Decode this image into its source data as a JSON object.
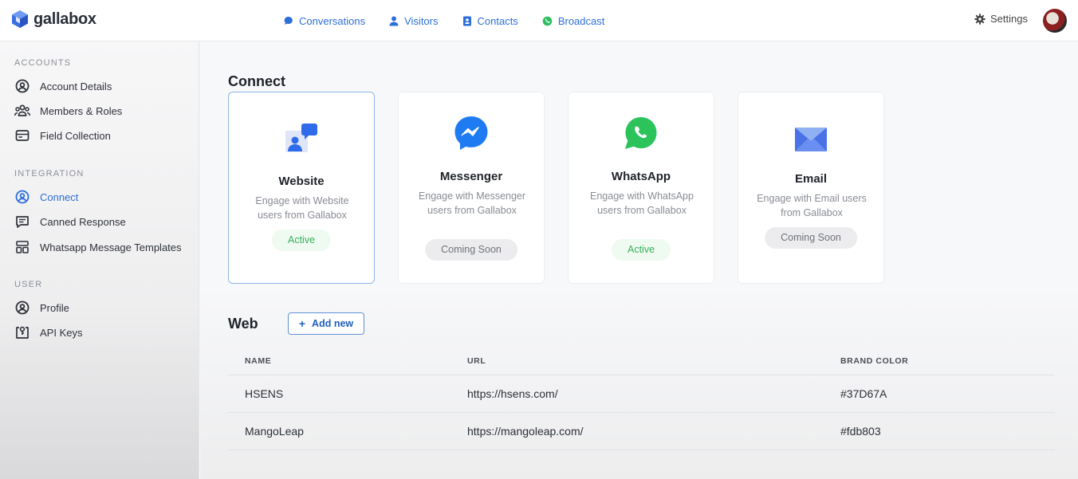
{
  "app": {
    "name": "gallabox"
  },
  "nav": {
    "items": [
      {
        "label": "Conversations",
        "icon": "chat-bubble-icon"
      },
      {
        "label": "Visitors",
        "icon": "person-icon"
      },
      {
        "label": "Contacts",
        "icon": "contact-card-icon"
      },
      {
        "label": "Broadcast",
        "icon": "whatsapp-icon"
      }
    ],
    "settings_label": "Settings"
  },
  "sidebar": {
    "accounts_title": "ACCOUNTS",
    "accounts": [
      {
        "label": "Account Details",
        "icon": "user-circle-icon"
      },
      {
        "label": "Members & Roles",
        "icon": "users-group-icon"
      },
      {
        "label": "Field Collection",
        "icon": "form-icon"
      }
    ],
    "integration_title": "INTEGRATION",
    "integration": [
      {
        "label": "Connect",
        "icon": "user-circle-icon",
        "active": true
      },
      {
        "label": "Canned Response",
        "icon": "message-icon"
      },
      {
        "label": "Whatsapp Message Templates",
        "icon": "template-icon"
      }
    ],
    "user_title": "USER",
    "user": [
      {
        "label": "Profile",
        "icon": "user-circle-icon"
      },
      {
        "label": "API Keys",
        "icon": "key-box-icon"
      }
    ]
  },
  "connect": {
    "title": "Connect",
    "cards": [
      {
        "title": "Website",
        "desc": "Engage with Website users from Gallabox",
        "status": "Active",
        "icon": "website-chat-icon"
      },
      {
        "title": "Messenger",
        "desc": "Engage with Messenger users from Gallabox",
        "status": "Coming Soon",
        "icon": "messenger-icon"
      },
      {
        "title": "WhatsApp",
        "desc": "Engage with WhatsApp users from Gallabox",
        "status": "Active",
        "icon": "whatsapp-icon"
      },
      {
        "title": "Email",
        "desc": "Engage with Email users from Gallabox",
        "status": "Coming Soon",
        "icon": "envelope-icon"
      }
    ]
  },
  "web": {
    "title": "Web",
    "add_label": "Add new",
    "columns": [
      "NAME",
      "URL",
      "BRAND COLOR"
    ],
    "rows": [
      {
        "name": "HSENS",
        "url": "https://hsens.com/",
        "color": "#37D67A"
      },
      {
        "name": "MangoLeap",
        "url": "https://mangoleap.com/",
        "color": "#fdb803"
      }
    ]
  },
  "colors": {
    "accent": "#2d6fd8",
    "active_green": "#36b05a"
  }
}
